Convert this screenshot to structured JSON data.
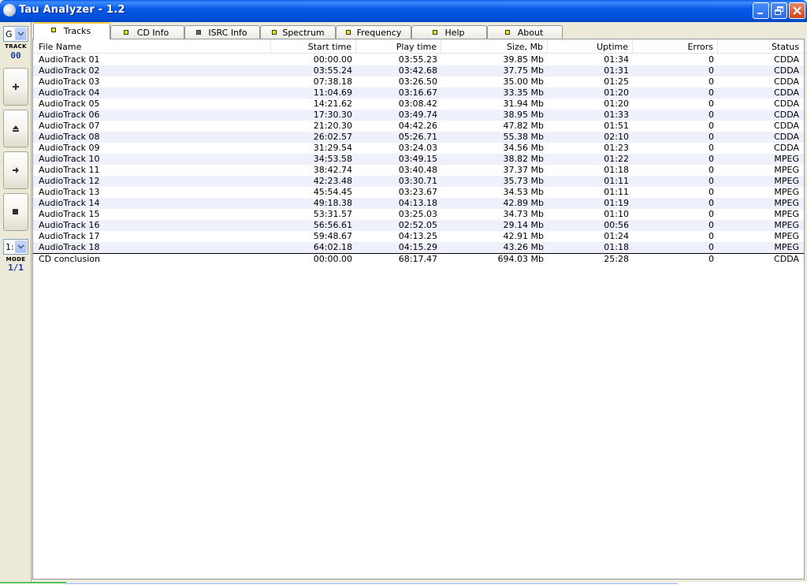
{
  "window": {
    "title": "Tau Analyzer - 1.2"
  },
  "left_panel": {
    "drive_combo": "G",
    "track_label": "TRACK",
    "track_value": "00",
    "mode_combo": "1:",
    "mode_label": "MODE",
    "mode_value": "1/1"
  },
  "tabs": [
    {
      "label": "Tracks",
      "marker": "yellow"
    },
    {
      "label": "CD Info",
      "marker": "yellow"
    },
    {
      "label": "ISRC Info",
      "marker": "gray"
    },
    {
      "label": "Spectrum",
      "marker": "yellow"
    },
    {
      "label": "Frequency",
      "marker": "yellow"
    },
    {
      "label": "Help",
      "marker": "yellow"
    },
    {
      "label": "About",
      "marker": "yellow"
    }
  ],
  "table": {
    "columns": [
      "File Name",
      "Start time",
      "Play time",
      "Size, Mb",
      "Uptime",
      "Errors",
      "Status"
    ],
    "rows": [
      [
        "AudioTrack 01",
        "00:00.00",
        "03:55.23",
        "39.85 Mb",
        "01:34",
        "0",
        "CDDA"
      ],
      [
        "AudioTrack 02",
        "03:55.24",
        "03:42.68",
        "37.75 Mb",
        "01:31",
        "0",
        "CDDA"
      ],
      [
        "AudioTrack 03",
        "07:38.18",
        "03:26.50",
        "35.00 Mb",
        "01:25",
        "0",
        "CDDA"
      ],
      [
        "AudioTrack 04",
        "11:04.69",
        "03:16.67",
        "33.35 Mb",
        "01:20",
        "0",
        "CDDA"
      ],
      [
        "AudioTrack 05",
        "14:21.62",
        "03:08.42",
        "31.94 Mb",
        "01:20",
        "0",
        "CDDA"
      ],
      [
        "AudioTrack 06",
        "17:30.30",
        "03:49.74",
        "38.95 Mb",
        "01:33",
        "0",
        "CDDA"
      ],
      [
        "AudioTrack 07",
        "21:20.30",
        "04:42.26",
        "47.82 Mb",
        "01:51",
        "0",
        "CDDA"
      ],
      [
        "AudioTrack 08",
        "26:02.57",
        "05:26.71",
        "55.38 Mb",
        "02:10",
        "0",
        "CDDA"
      ],
      [
        "AudioTrack 09",
        "31:29.54",
        "03:24.03",
        "34.56 Mb",
        "01:23",
        "0",
        "CDDA"
      ],
      [
        "AudioTrack 10",
        "34:53.58",
        "03:49.15",
        "38.82 Mb",
        "01:22",
        "0",
        "MPEG"
      ],
      [
        "AudioTrack 11",
        "38:42.74",
        "03:40.48",
        "37.37 Mb",
        "01:18",
        "0",
        "MPEG"
      ],
      [
        "AudioTrack 12",
        "42:23.48",
        "03:30.71",
        "35.73 Mb",
        "01:11",
        "0",
        "MPEG"
      ],
      [
        "AudioTrack 13",
        "45:54.45",
        "03:23.67",
        "34.53 Mb",
        "01:11",
        "0",
        "MPEG"
      ],
      [
        "AudioTrack 14",
        "49:18.38",
        "04:13.18",
        "42.89 Mb",
        "01:19",
        "0",
        "MPEG"
      ],
      [
        "AudioTrack 15",
        "53:31.57",
        "03:25.03",
        "34.73 Mb",
        "01:10",
        "0",
        "MPEG"
      ],
      [
        "AudioTrack 16",
        "56:56.61",
        "02:52.05",
        "29.14 Mb",
        "00:56",
        "0",
        "MPEG"
      ],
      [
        "AudioTrack 17",
        "59:48.67",
        "04:13.25",
        "42.91 Mb",
        "01:24",
        "0",
        "MPEG"
      ],
      [
        "AudioTrack 18",
        "64:02.18",
        "04:15.29",
        "43.26 Mb",
        "01:18",
        "0",
        "MPEG"
      ]
    ],
    "summary": [
      "CD conclusion",
      "00:00.00",
      "68:17.47",
      "694.03 Mb",
      "25:28",
      "0",
      "CDDA"
    ]
  }
}
